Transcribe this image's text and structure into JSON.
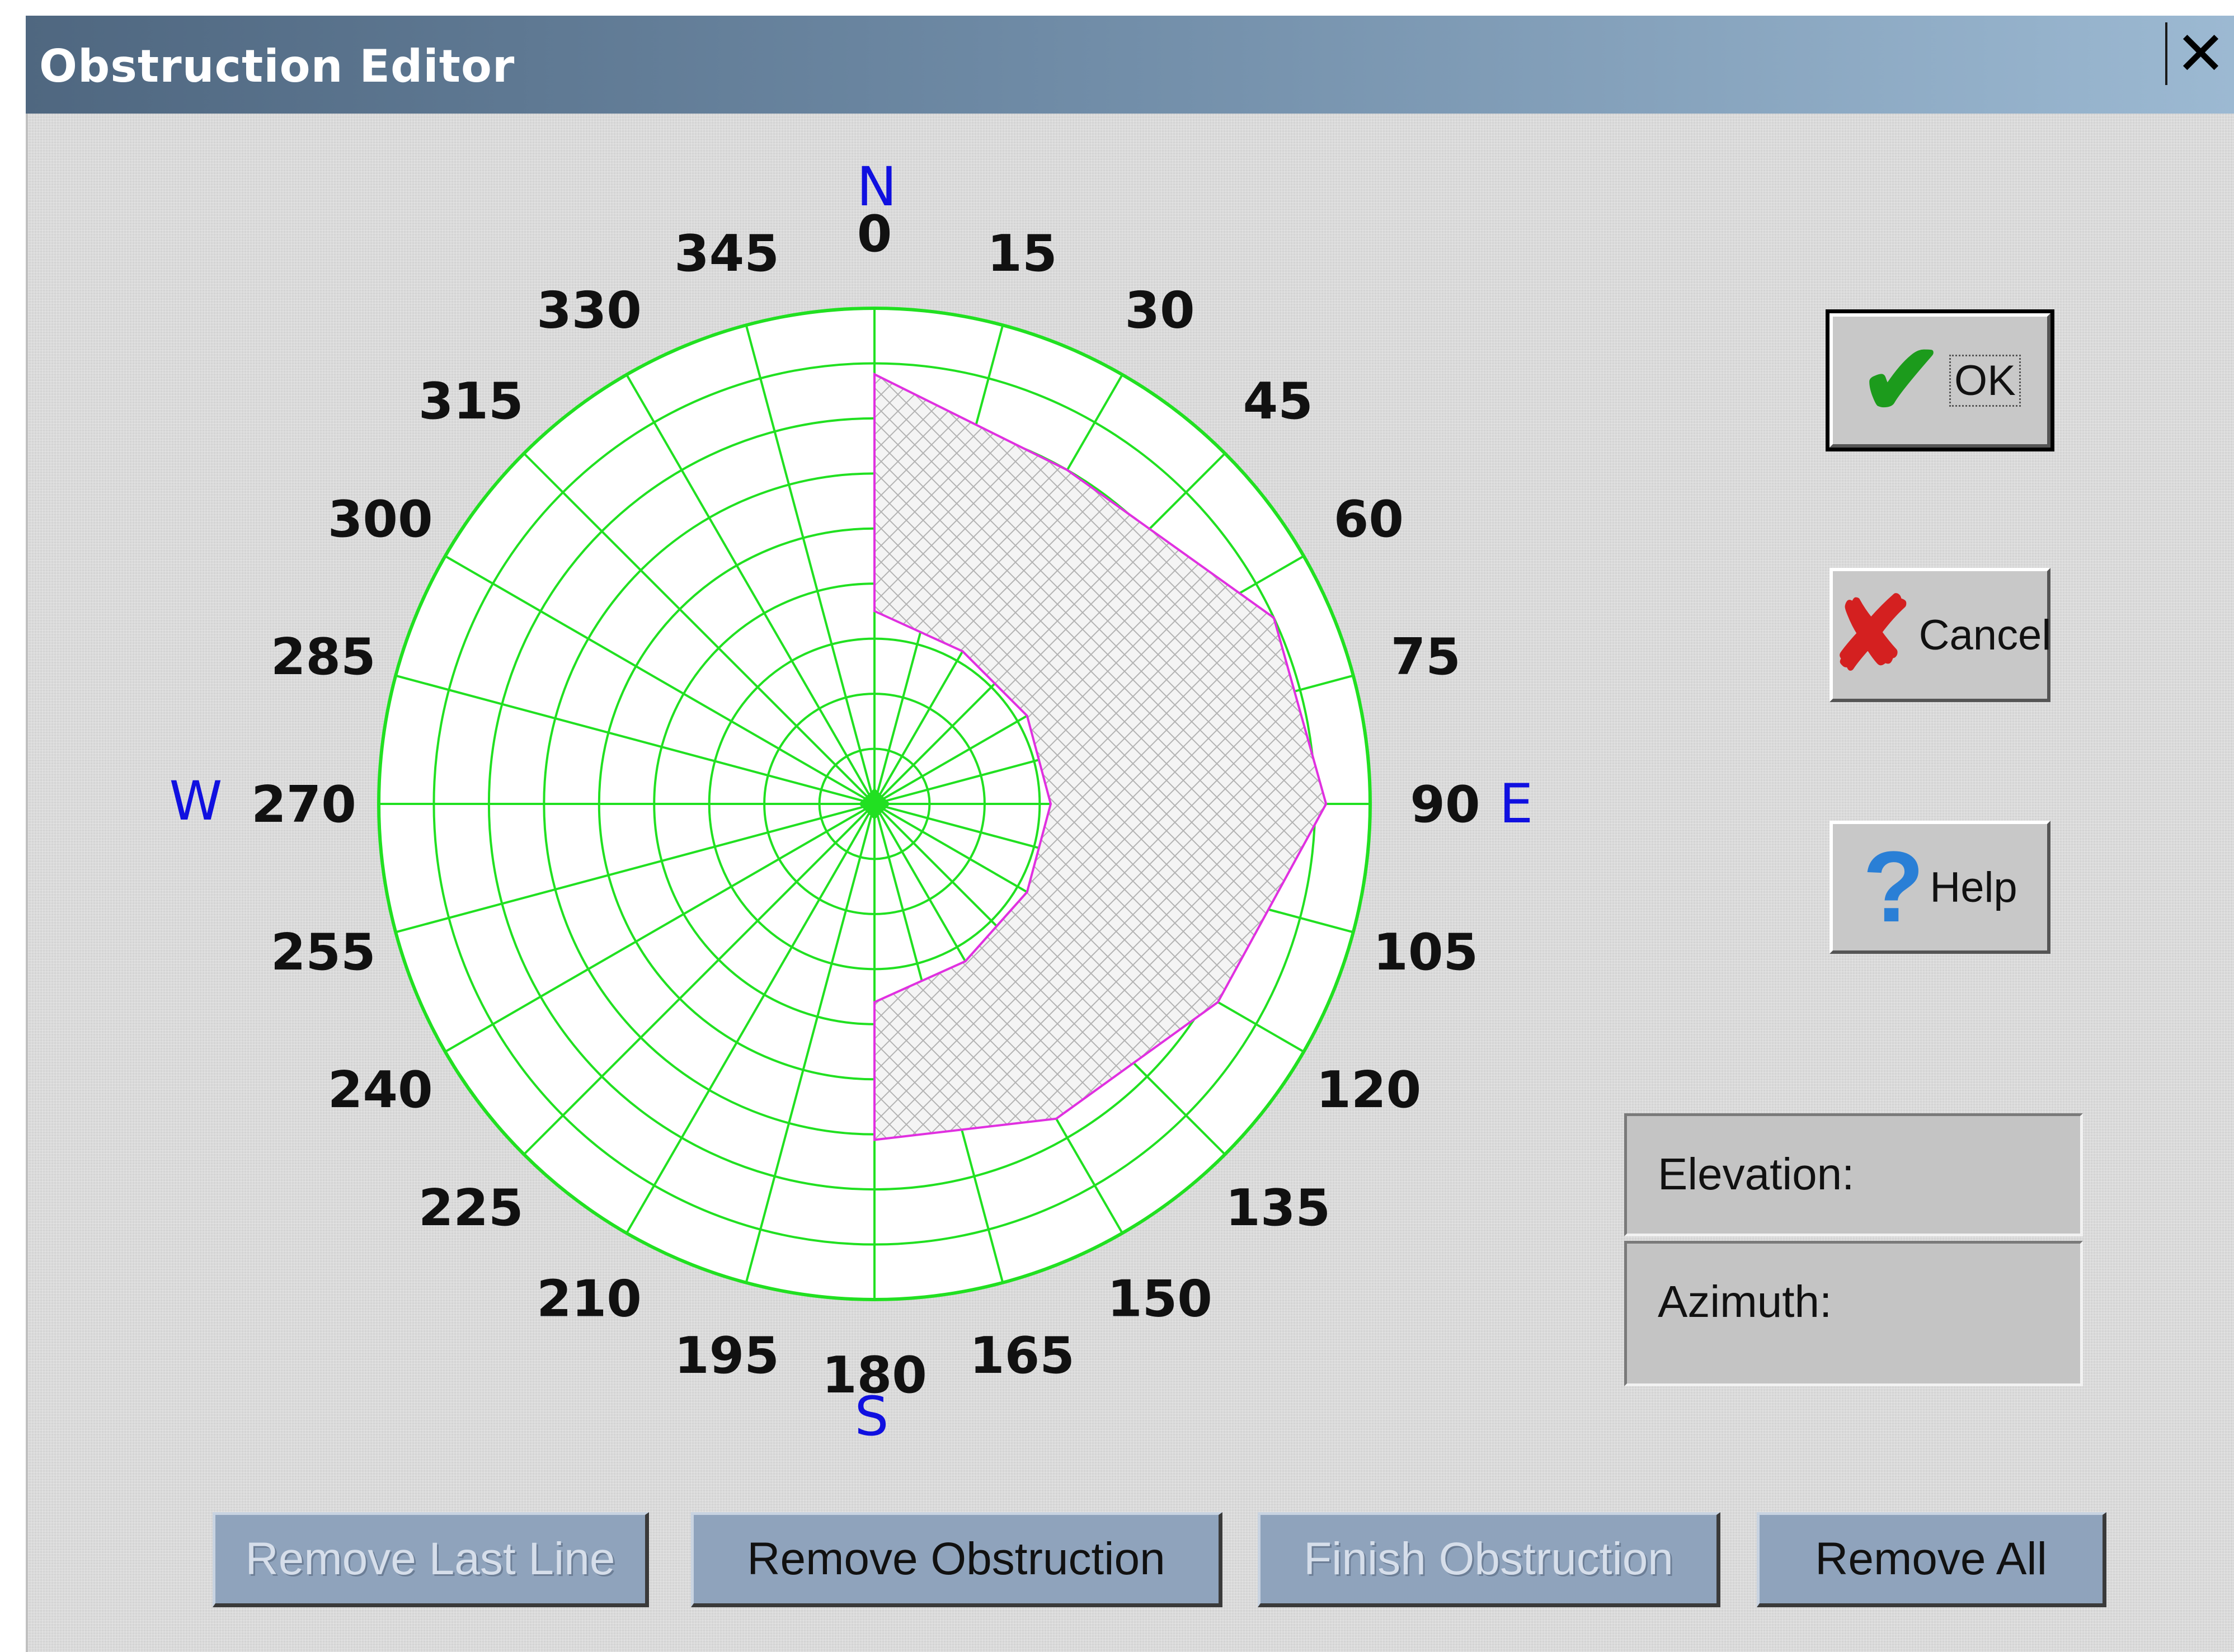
{
  "window": {
    "title": "Obstruction Editor",
    "close_glyph": "✕"
  },
  "compass": {
    "north": "N",
    "south": "S",
    "east": "E",
    "west": "W",
    "azimuth_labels": [
      "0",
      "15",
      "30",
      "45",
      "60",
      "75",
      "90",
      "105",
      "120",
      "135",
      "150",
      "165",
      "180",
      "195",
      "210",
      "225",
      "240",
      "255",
      "270",
      "285",
      "300",
      "315",
      "330",
      "345"
    ],
    "rings": 9,
    "spokes_every_deg": 15,
    "grid_color": "#21e021",
    "obstruction_outline_color": "#e030e0",
    "obstruction_fill": "crosshatch"
  },
  "obstruction": {
    "outer_boundary": [
      {
        "azimuth": 0,
        "elevation": 12
      },
      {
        "azimuth": 30,
        "elevation": 20
      },
      {
        "azimuth": 65,
        "elevation": 10
      },
      {
        "azimuth": 90,
        "elevation": 8
      },
      {
        "azimuth": 120,
        "elevation": 18
      },
      {
        "azimuth": 150,
        "elevation": 24
      },
      {
        "azimuth": 180,
        "elevation": 29
      }
    ],
    "inner_boundary": [
      {
        "azimuth": 180,
        "elevation": 54
      },
      {
        "azimuth": 150,
        "elevation": 57
      },
      {
        "azimuth": 120,
        "elevation": 58
      },
      {
        "azimuth": 90,
        "elevation": 58
      },
      {
        "azimuth": 60,
        "elevation": 58
      },
      {
        "azimuth": 30,
        "elevation": 58
      },
      {
        "azimuth": 0,
        "elevation": 55
      }
    ]
  },
  "buttons": {
    "ok": {
      "label": "OK",
      "icon": "checkmark-icon"
    },
    "cancel": {
      "label": "Cancel",
      "icon": "red-x-icon"
    },
    "help": {
      "label": "Help",
      "icon": "question-mark-icon"
    }
  },
  "status": {
    "elevation_label": "Elevation:",
    "azimuth_label": "Azimuth:"
  },
  "bottom_buttons": [
    {
      "label": "Remove Last Line",
      "enabled": false
    },
    {
      "label": "Remove Obstruction",
      "enabled": true
    },
    {
      "label": "Finish Obstruction",
      "enabled": false
    },
    {
      "label": "Remove All",
      "enabled": true
    }
  ]
}
